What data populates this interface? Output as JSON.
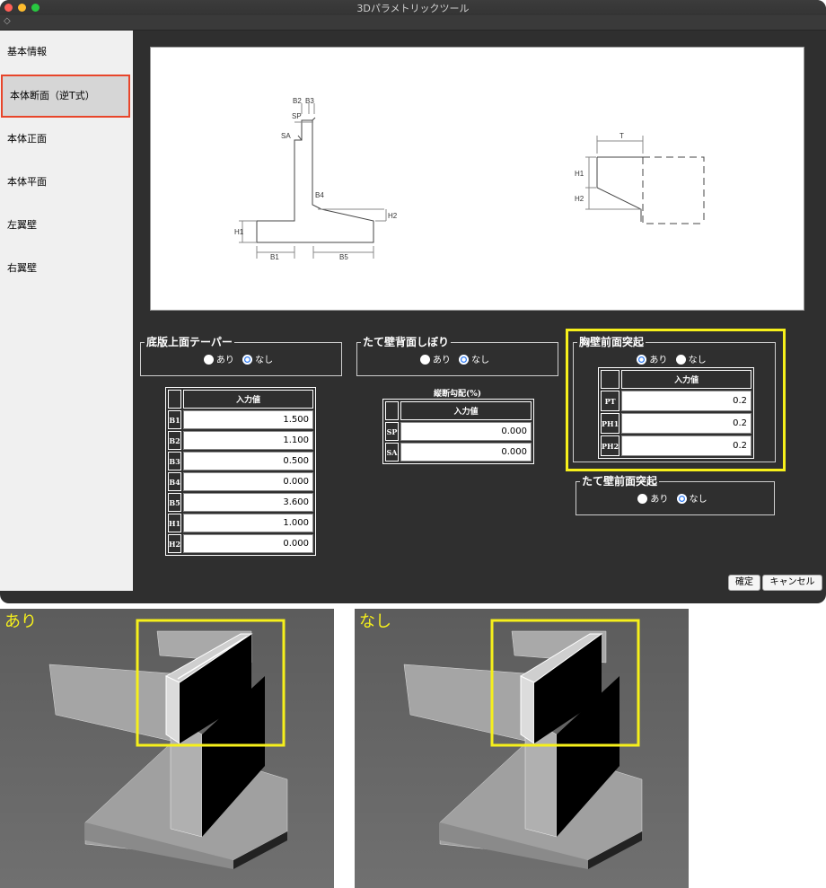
{
  "window": {
    "title": "3Dパラメトリックツール"
  },
  "sidebar": {
    "items": [
      {
        "label": "基本情報"
      },
      {
        "label": "本体断面（逆T式）"
      },
      {
        "label": "本体正面"
      },
      {
        "label": "本体平面"
      },
      {
        "label": "左翼壁"
      },
      {
        "label": "右翼壁"
      }
    ],
    "selected_index": 1
  },
  "diagram": {
    "labels": {
      "b2": "B2",
      "b3": "B3",
      "sp": "SP",
      "sa": "SA",
      "b4": "B4",
      "h1": "H1",
      "h2": "H2",
      "b1": "B1",
      "b5": "B5",
      "t": "T"
    }
  },
  "group_taper": {
    "title": "底版上面テーパー",
    "options": [
      "あり",
      "なし"
    ],
    "selected": "なし",
    "table": {
      "header": "入力値",
      "rows": [
        {
          "label": "B1",
          "value": "1.500"
        },
        {
          "label": "B2",
          "value": "1.100"
        },
        {
          "label": "B3",
          "value": "0.500"
        },
        {
          "label": "B4",
          "value": "0.000"
        },
        {
          "label": "B5",
          "value": "3.600"
        },
        {
          "label": "H1",
          "value": "1.000"
        },
        {
          "label": "H2",
          "value": "0.000"
        }
      ]
    }
  },
  "group_back": {
    "title": "たて壁背面しぼり",
    "options": [
      "あり",
      "なし"
    ],
    "selected": "なし",
    "slope_title": "縦断勾配(%)",
    "table": {
      "header": "入力値",
      "rows": [
        {
          "label": "SP",
          "value": "0.000"
        },
        {
          "label": "SA",
          "value": "0.000"
        }
      ]
    }
  },
  "group_parapet": {
    "title": "胸壁前面突起",
    "options": [
      "あり",
      "なし"
    ],
    "selected": "あり",
    "table": {
      "header": "入力値",
      "rows": [
        {
          "label": "PT",
          "value": "0.2"
        },
        {
          "label": "PH1",
          "value": "0.2"
        },
        {
          "label": "PH2",
          "value": "0.2"
        }
      ]
    }
  },
  "group_front": {
    "title": "たて壁前面突起",
    "options": [
      "あり",
      "なし"
    ],
    "selected": "なし"
  },
  "buttons": {
    "confirm": "確定",
    "cancel": "キャンセル"
  },
  "previews": [
    {
      "label": "あり"
    },
    {
      "label": "なし"
    }
  ],
  "colors": {
    "accent_red": "#e8452a",
    "highlight_yellow": "#f6f01b",
    "radio_blue": "#2d7cf6"
  }
}
